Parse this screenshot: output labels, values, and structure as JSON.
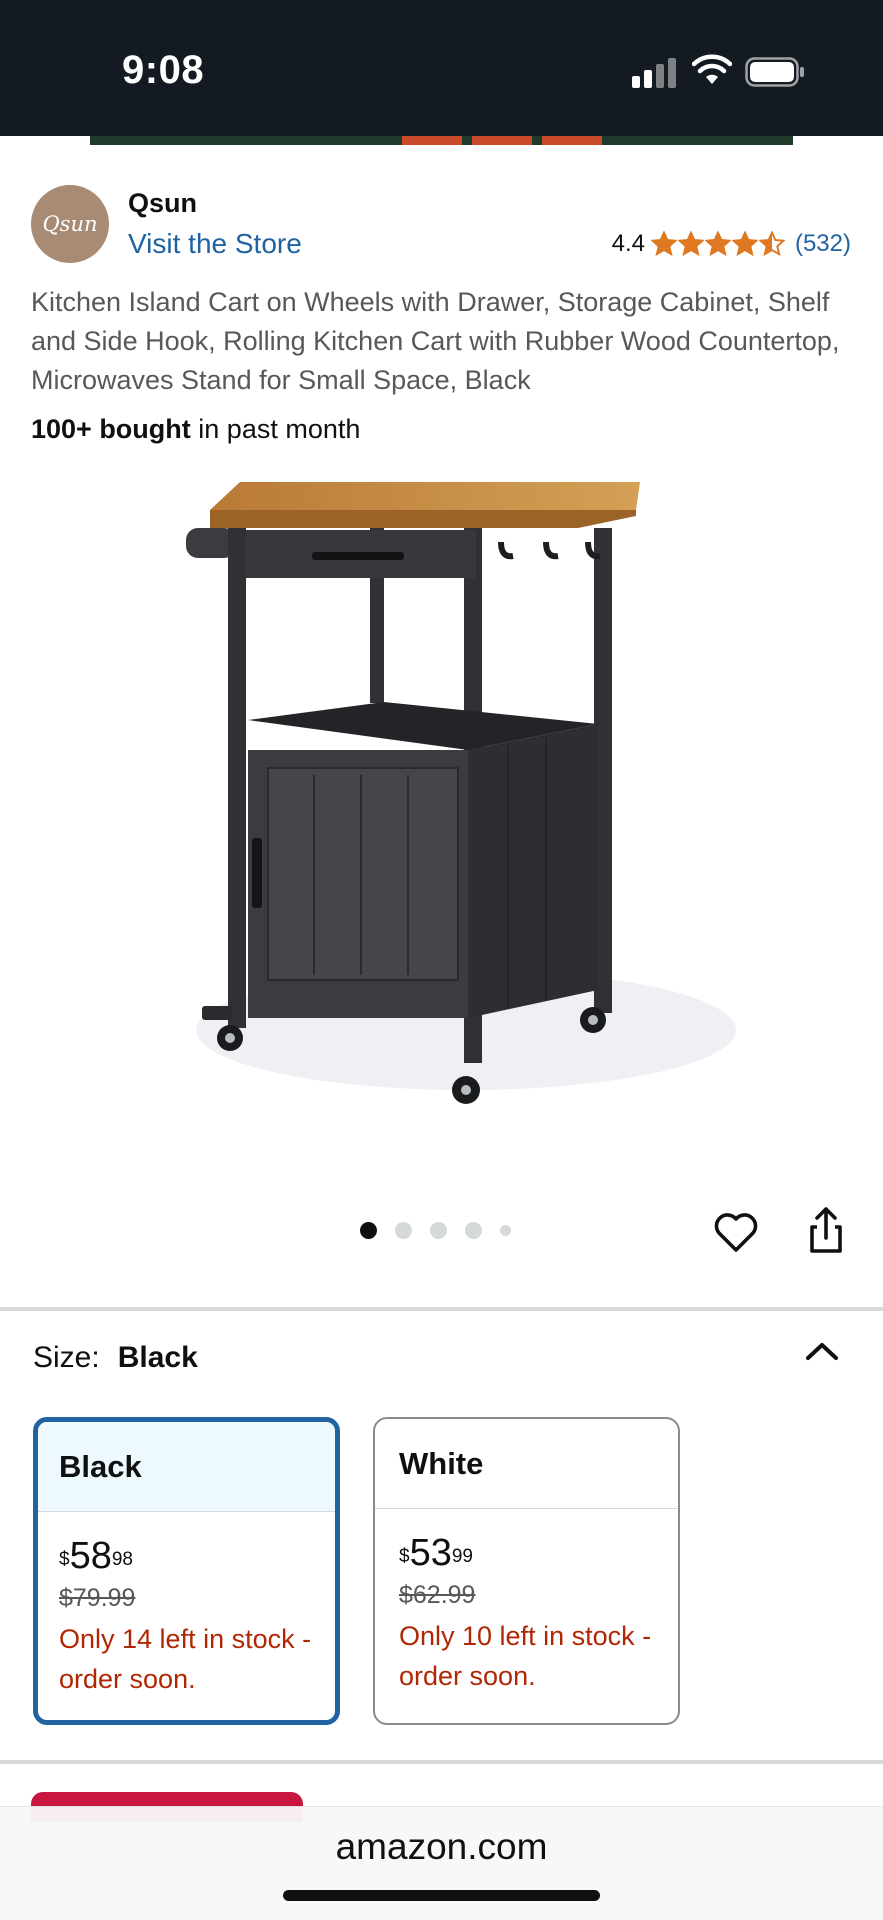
{
  "status_bar": {
    "time": "9:08",
    "icons": [
      "cellular-signal-icon",
      "wifi-icon",
      "battery-icon"
    ]
  },
  "brand": {
    "avatar_text": "Qsun",
    "name": "Qsun",
    "visit_store": "Visit the Store"
  },
  "rating": {
    "value": "4.4",
    "stars": 4.4,
    "count": "(532)",
    "star_color": "#de7921"
  },
  "product": {
    "title": "Kitchen Island Cart on Wheels with Drawer, Storage Cabinet, Shelf and Side Hook, Rolling Kitchen Cart with Rubber Wood Countertop, Microwaves Stand for Small Space, Black",
    "bought_bold": "100+ bought",
    "bought_rest": " in past month"
  },
  "gallery": {
    "image_count": 5,
    "active_index": 0
  },
  "size": {
    "label": "Size:",
    "selected": "Black",
    "options": [
      {
        "name": "Black",
        "price_symbol": "$",
        "price_whole": "58",
        "price_cents": "98",
        "list_price": "$79.99",
        "stock": "Only 14 left in stock - order soon."
      },
      {
        "name": "White",
        "price_symbol": "$",
        "price_whole": "53",
        "price_cents": "99",
        "list_price": "$62.99",
        "stock": "Only 10 left in stock - order soon."
      }
    ]
  },
  "browser": {
    "url": "amazon.com"
  },
  "colors": {
    "link": "#2162a1",
    "stock_warning": "#b12704",
    "selected_border": "#2162a1",
    "header_bg": "#131a22"
  }
}
